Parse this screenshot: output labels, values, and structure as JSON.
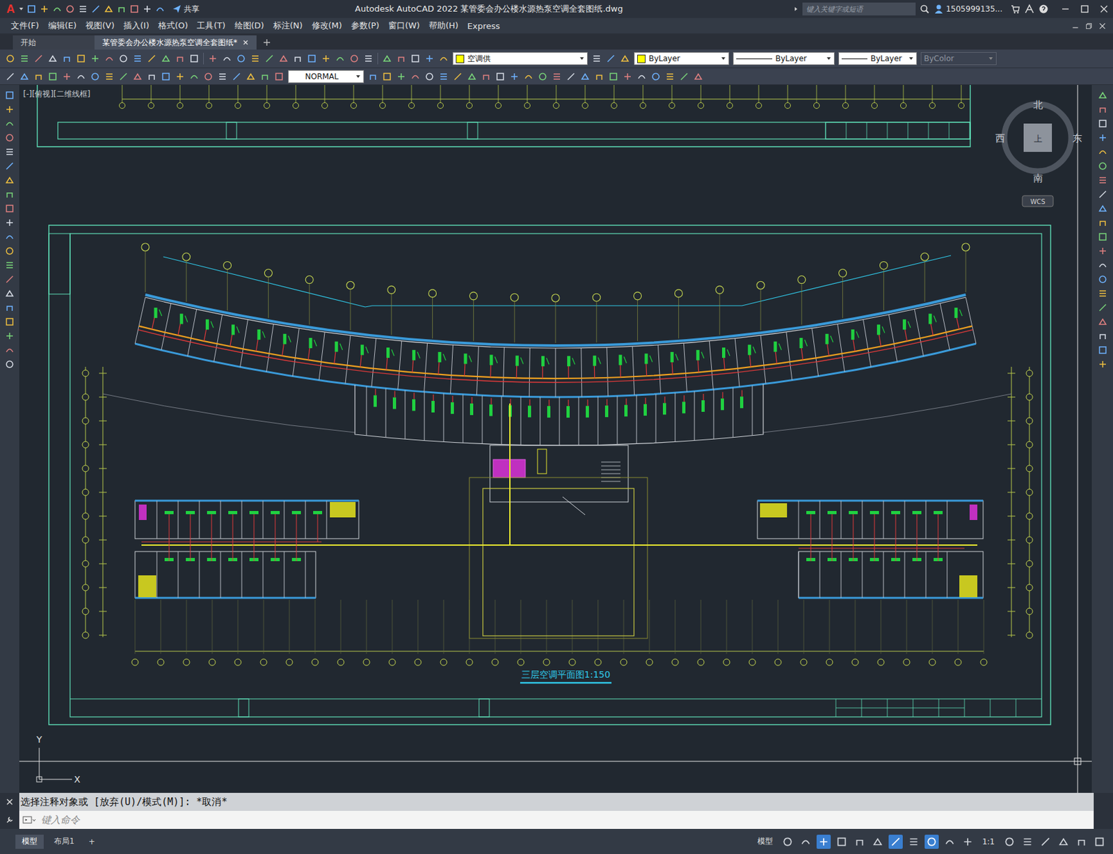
{
  "window": {
    "logo": "A",
    "title": "Autodesk AutoCAD 2022    某管委会办公楼水源热泵空调全套图纸.dwg",
    "share": "共享",
    "search_placeholder": "键入关键字或短语",
    "user": "1505999135..."
  },
  "menus": [
    "文件(F)",
    "编辑(E)",
    "视图(V)",
    "插入(I)",
    "格式(O)",
    "工具(T)",
    "绘图(D)",
    "标注(N)",
    "修改(M)",
    "参数(P)",
    "窗口(W)",
    "帮助(H)",
    "Express"
  ],
  "file_tabs": [
    {
      "label": "开始",
      "selected": false
    },
    {
      "label": "某管委会办公楼水源热泵空调全套图纸*",
      "selected": true
    }
  ],
  "properties": {
    "layer": {
      "name": "空调供",
      "color": "#ffff00"
    },
    "color": {
      "label": "ByLayer",
      "color": "#ffff00"
    },
    "linetype": "ByLayer",
    "lineweight": "ByLayer",
    "plotstyle": {
      "label": "ByColor",
      "disabled": true
    },
    "text_style": "NORMAL"
  },
  "viewport": {
    "label": "[-][俯视][二维线框]",
    "compass": {
      "north": "北",
      "south": "南",
      "east": "东",
      "west": "西",
      "top": "上"
    },
    "ucs": "WCS",
    "axes": {
      "x": "X",
      "y": "Y"
    }
  },
  "drawing": {
    "title": "三层空调平面图1:150"
  },
  "command": {
    "history": "选择注释对象或 [放弃(U)/模式(M)]: *取消*",
    "placeholder": "键入命令"
  },
  "layout_tabs": [
    {
      "label": "模型",
      "selected": true
    },
    {
      "label": "布局1",
      "selected": false
    }
  ],
  "add_layout": "+",
  "status_bar": {
    "space": "模型",
    "scale": "1:1",
    "toggles": [
      {
        "on": false
      },
      {
        "on": false
      },
      {
        "on": true
      },
      {
        "on": false
      },
      {
        "on": false
      },
      {
        "on": false
      },
      {
        "on": true
      },
      {
        "on": false
      },
      {
        "on": true
      },
      {
        "on": false
      },
      {
        "on": false
      }
    ]
  }
}
